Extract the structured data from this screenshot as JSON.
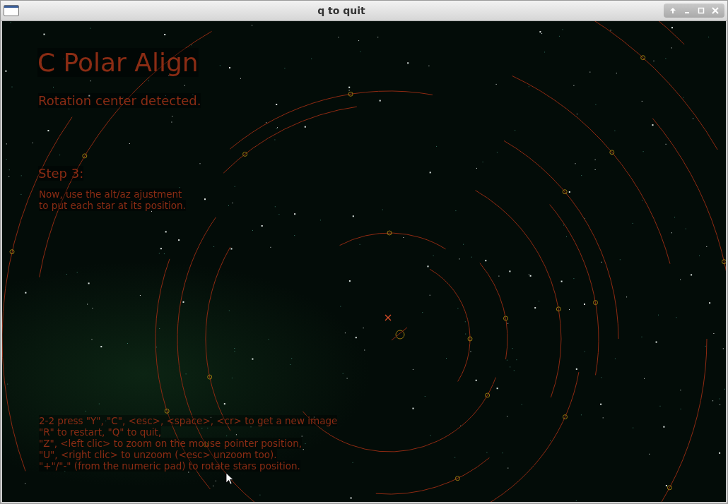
{
  "window": {
    "title": "q to quit"
  },
  "heading": "C Polar Align",
  "status": "Rotation center detected.",
  "step": {
    "title": "Step 3:",
    "lines": [
      "Now, use the alt/az ajustment",
      "to put each star at its position."
    ]
  },
  "help_lines": [
    "2-2  press \"Y\", \"C\", <esc>, <space>, <cr> to get a new  image",
    "\"R\" to restart, \"Q\" to quit,",
    "\"Z\", <left clic> to zoom on the mouse pointer position,",
    "\"U\", <right clic> to unzoom (<esc> unzoom too).",
    "\"+\"/\"-\" (from the numeric pad) to rotate stars position."
  ]
}
